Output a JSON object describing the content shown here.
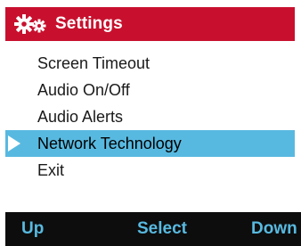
{
  "header": {
    "title": "Settings",
    "icon": "gears-icon",
    "background_color": "#c8102e"
  },
  "menu": {
    "items": [
      {
        "label": "Screen Timeout",
        "selected": false
      },
      {
        "label": "Audio On/Off",
        "selected": false
      },
      {
        "label": "Audio Alerts",
        "selected": false
      },
      {
        "label": "Network Technology",
        "selected": true
      },
      {
        "label": "Exit",
        "selected": false
      }
    ],
    "highlight_color": "#58b9e0"
  },
  "softkeys": {
    "left": "Up",
    "center": "Select",
    "right": "Down",
    "color": "#58b9e0"
  }
}
